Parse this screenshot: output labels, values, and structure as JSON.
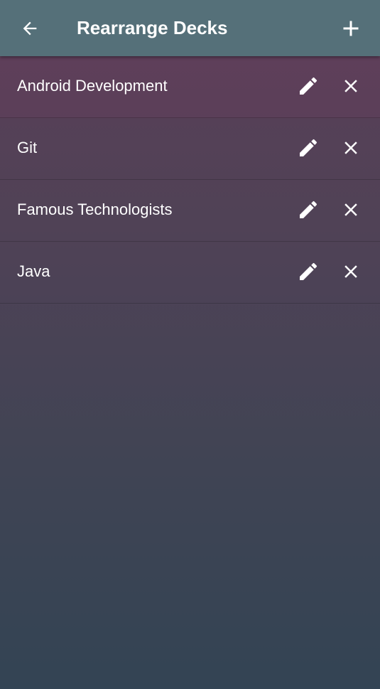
{
  "appbar": {
    "title": "Rearrange Decks",
    "back_icon": "arrow-left-icon",
    "add_icon": "plus-icon",
    "color": "#557079"
  },
  "decks": [
    {
      "name": "Android Development",
      "edit_icon": "pencil-icon",
      "delete_icon": "close-icon"
    },
    {
      "name": "Git",
      "edit_icon": "pencil-icon",
      "delete_icon": "close-icon"
    },
    {
      "name": "Famous Technologists",
      "edit_icon": "pencil-icon",
      "delete_icon": "close-icon"
    },
    {
      "name": "Java",
      "edit_icon": "pencil-icon",
      "delete_icon": "close-icon"
    }
  ],
  "colors": {
    "background_top": "#5b3f58",
    "background_bottom": "#334454",
    "text": "#ffffff"
  }
}
